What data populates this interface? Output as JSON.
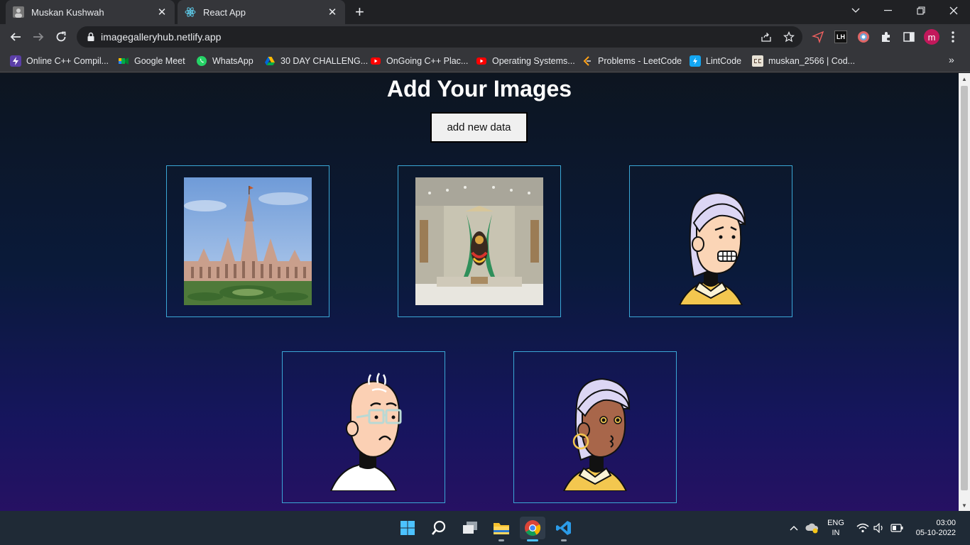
{
  "browser": {
    "tabs": [
      {
        "title": "Muskan Kushwah",
        "active": false
      },
      {
        "title": "React App",
        "active": true
      }
    ],
    "url": "imagegalleryhub.netlify.app",
    "profile_initial": "m",
    "ext_lh_label": "LH",
    "bookmarks": [
      {
        "label": "Online C++ Compil...",
        "icon": "lightning-icon"
      },
      {
        "label": "Google Meet",
        "icon": "google-meet-icon"
      },
      {
        "label": "WhatsApp",
        "icon": "whatsapp-icon"
      },
      {
        "label": "30 DAY CHALLENG...",
        "icon": "google-drive-icon"
      },
      {
        "label": "OnGoing C++ Plac...",
        "icon": "youtube-icon"
      },
      {
        "label": "Operating Systems...",
        "icon": "youtube-icon"
      },
      {
        "label": "Problems - LeetCode",
        "icon": "leetcode-icon"
      },
      {
        "label": "LintCode",
        "icon": "lintcode-icon"
      },
      {
        "label": "muskan_2566 | Cod...",
        "icon": "codechef-icon"
      }
    ],
    "more_bookmarks": "»"
  },
  "page": {
    "title": "Add Your Images",
    "add_button_label": "add new data",
    "gallery": [
      {
        "alt": "temple photo"
      },
      {
        "alt": "shrine interior photo"
      },
      {
        "alt": "grimacing character illustration"
      },
      {
        "alt": "bald character with glasses illustration"
      },
      {
        "alt": "character with hoop earring illustration"
      }
    ]
  },
  "taskbar": {
    "lang_line1": "ENG",
    "lang_line2": "IN",
    "time": "03:00",
    "date": "05-10-2022"
  },
  "colors": {
    "card_border": "#3aa7d6",
    "button_bg": "#f0f0f0",
    "chrome_bar": "#35363a",
    "tab_strip": "#202124",
    "taskbar": "#1f2a36",
    "accent": "#4cc2ff"
  }
}
